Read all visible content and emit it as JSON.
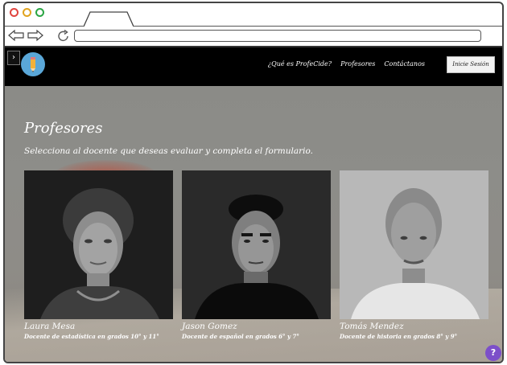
{
  "navbar": {
    "sidebar_toggle": "›",
    "links": [
      "¿Qué es ProfeCide?",
      "Profesores",
      "Contáctanos"
    ],
    "login_label": "Inicie Sesión"
  },
  "main": {
    "title": "Profesores",
    "subtitle": "Selecciona al docente que deseas evaluar y completa el formulario."
  },
  "teachers": [
    {
      "name": "Laura Mesa",
      "description": "Docente de estadística en grados 10° y 11°"
    },
    {
      "name": "Jason Gomez",
      "description": "Docente de español en grados 6° y 7°"
    },
    {
      "name": "Tomás Mendez",
      "description": "Docente de historia en grados 8° y 9°"
    }
  ],
  "help": {
    "label": "?"
  },
  "colors": {
    "navbar_bg": "#000000",
    "logo_bg": "#5aa7d8",
    "help_bg": "#7c4fc9",
    "page_bg": "#8a8a86"
  },
  "icons": {
    "logo": "pencil-icon",
    "back": "arrow-left-icon",
    "forward": "arrow-right-icon",
    "reload": "reload-icon",
    "help": "question-icon"
  }
}
